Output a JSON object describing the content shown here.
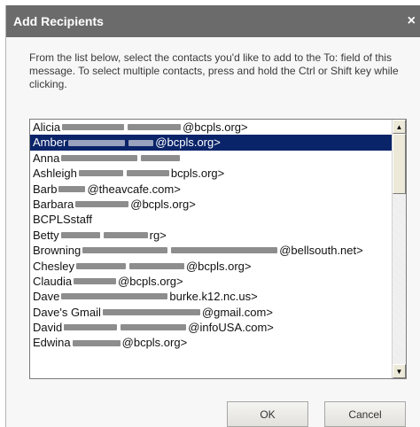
{
  "dialog": {
    "title": "Add Recipients",
    "close_glyph": "×",
    "instructions": "From the list below, select the contacts you'd like to add to the To: field of this message. To select multiple contacts, press and hold the Ctrl or Shift key while clicking."
  },
  "contacts": [
    {
      "name": "Alicia",
      "tail": "@bcpls.org>",
      "selected": false
    },
    {
      "name": "Amber",
      "tail": "@bcpls.org>",
      "selected": true
    },
    {
      "name": "Anna",
      "tail": "",
      "selected": false
    },
    {
      "name": "Ashleigh",
      "tail": "bcpls.org>",
      "selected": false
    },
    {
      "name": "Barb",
      "tail": "@theavcafe.com>",
      "selected": false
    },
    {
      "name": "Barbara",
      "tail": "@bcpls.org>",
      "selected": false
    },
    {
      "name": "BCPLSstaff",
      "tail": "",
      "selected": false
    },
    {
      "name": "Betty",
      "tail": "rg>",
      "selected": false
    },
    {
      "name": "Browning",
      "tail": "@bellsouth.net>",
      "selected": false
    },
    {
      "name": "Chesley",
      "tail": "@bcpls.org>",
      "selected": false
    },
    {
      "name": "Claudia",
      "tail": "@bcpls.org>",
      "selected": false
    },
    {
      "name": "Dave",
      "tail": "burke.k12.nc.us>",
      "selected": false
    },
    {
      "name": "Dave's Gmail",
      "tail": "@gmail.com>",
      "selected": false
    },
    {
      "name": "David",
      "tail": "@infoUSA.com>",
      "selected": false
    },
    {
      "name": "Edwina",
      "tail": "@bcpls.org>",
      "selected": false
    }
  ],
  "buttons": {
    "ok_label": "OK",
    "cancel_label": "Cancel"
  },
  "scrollbar": {
    "up_icon": "triangle-up",
    "down_icon": "triangle-down"
  },
  "colors": {
    "titlebar": "#6b6b6b",
    "selection": "#0a246a"
  }
}
